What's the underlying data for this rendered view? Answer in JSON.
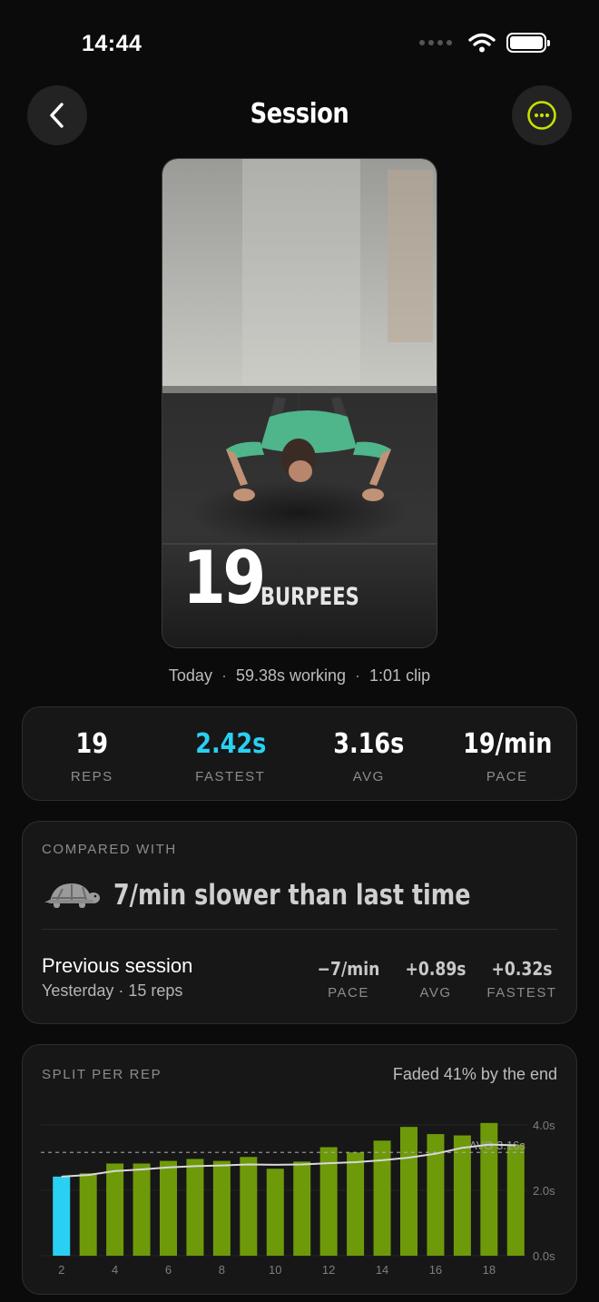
{
  "status_bar": {
    "time": "14:44"
  },
  "header": {
    "title": "Session"
  },
  "video": {
    "rep_count": "19",
    "exercise": "BURPEES"
  },
  "meta": {
    "day": "Today",
    "working": "59.38s working",
    "clip": "1:01 clip"
  },
  "stats": [
    {
      "value": "19",
      "label": "REPS"
    },
    {
      "value": "2.42s",
      "label": "FASTEST"
    },
    {
      "value": "3.16s",
      "label": "AVG"
    },
    {
      "value": "19/min",
      "label": "PACE"
    }
  ],
  "compare": {
    "label": "COMPARED WITH",
    "headline": "7/min slower than last time",
    "icon": "turtle-icon",
    "previous_title": "Previous session",
    "previous_sub": "Yesterday · 15 reps",
    "deltas": [
      {
        "value": "−7/min",
        "label": "PACE"
      },
      {
        "value": "+0.89s",
        "label": "AVG"
      },
      {
        "value": "+0.32s",
        "label": "FASTEST"
      }
    ]
  },
  "split": {
    "label": "SPLIT PER REP",
    "note": "Faded 41% by the end"
  },
  "colors": {
    "accent_cyan": "#2ad0f2",
    "accent_lime": "#c8e000",
    "bar_green": "#6e9a0a",
    "background": "#0b0b0b",
    "card": "#171717"
  },
  "chart_data": {
    "type": "bar",
    "x": [
      2,
      3,
      4,
      5,
      6,
      7,
      8,
      9,
      10,
      11,
      12,
      13,
      14,
      15,
      16,
      17,
      18,
      19
    ],
    "x_tick_labels": [
      "2",
      "4",
      "6",
      "8",
      "10",
      "12",
      "14",
      "16",
      "18"
    ],
    "values": [
      2.42,
      2.52,
      2.82,
      2.82,
      2.9,
      2.96,
      2.9,
      3.02,
      2.66,
      2.88,
      3.32,
      3.16,
      3.52,
      3.94,
      3.72,
      3.68,
      4.06,
      3.4
    ],
    "trend": [
      2.42,
      2.47,
      2.59,
      2.64,
      2.7,
      2.74,
      2.76,
      2.79,
      2.78,
      2.79,
      2.83,
      2.86,
      2.92,
      3.0,
      3.12,
      3.3,
      3.4,
      3.38
    ],
    "fastest_index": 0,
    "avg": 3.16,
    "avg_label": "AVG 3.16s",
    "y_tick_labels": [
      "0.0s",
      "2.0s",
      "4.0s"
    ],
    "ylim": [
      0,
      4
    ],
    "grid": true
  }
}
